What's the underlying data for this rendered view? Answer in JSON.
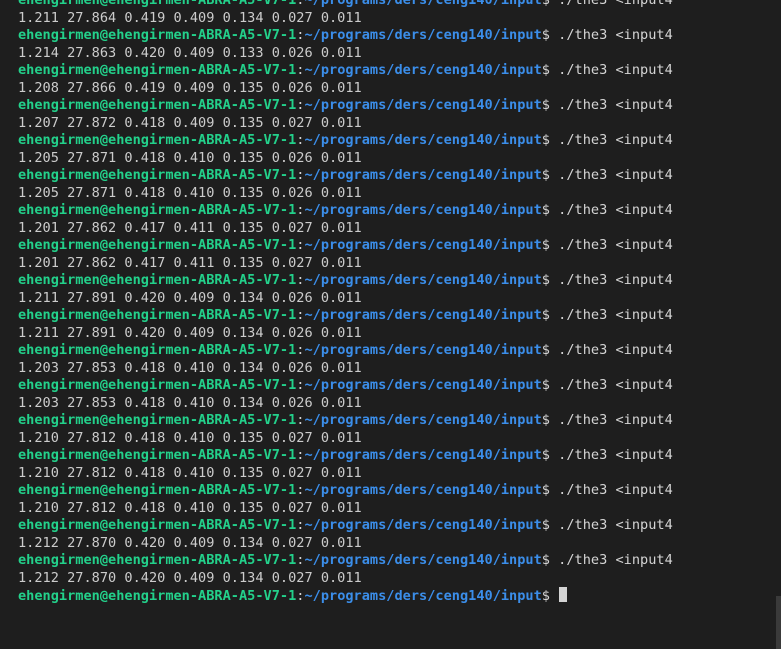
{
  "terminal": {
    "prompt_user": "ehengirmen@ehengirmen-ABRA-A5-V7-1",
    "prompt_sep": ":",
    "prompt_path": "~/programs/ders/ceng140/input",
    "prompt_symbol": "$",
    "command": "./the3 <input4",
    "outputs": [
      "1.211 27.864 0.419 0.409 0.134 0.027 0.011",
      "1.214 27.863 0.420 0.409 0.133 0.026 0.011",
      "1.208 27.866 0.419 0.409 0.135 0.026 0.011",
      "1.207 27.872 0.418 0.409 0.135 0.027 0.011",
      "1.205 27.871 0.418 0.410 0.135 0.026 0.011",
      "1.205 27.871 0.418 0.410 0.135 0.026 0.011",
      "1.201 27.862 0.417 0.411 0.135 0.027 0.011",
      "1.201 27.862 0.417 0.411 0.135 0.027 0.011",
      "1.211 27.891 0.420 0.409 0.134 0.026 0.011",
      "1.211 27.891 0.420 0.409 0.134 0.026 0.011",
      "1.203 27.853 0.418 0.410 0.134 0.026 0.011",
      "1.203 27.853 0.418 0.410 0.134 0.026 0.011",
      "1.210 27.812 0.418 0.410 0.135 0.027 0.011",
      "1.210 27.812 0.418 0.410 0.135 0.027 0.011",
      "1.210 27.812 0.418 0.410 0.135 0.027 0.011",
      "1.212 27.870 0.420 0.409 0.134 0.027 0.011",
      "1.212 27.870 0.420 0.409 0.134 0.027 0.011"
    ]
  }
}
